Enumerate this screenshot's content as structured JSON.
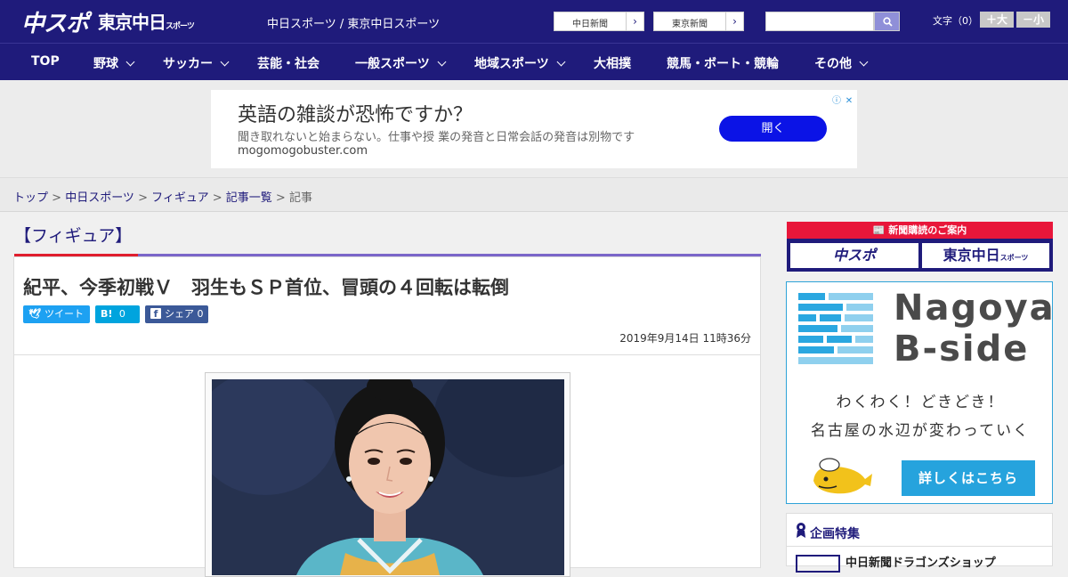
{
  "header": {
    "logo_main": "中スポ",
    "logo_tokyo": "東京中日",
    "logo_tokyo_sub": "スポーツ",
    "site_title": "中日スポーツ / 東京中日スポーツ",
    "paper_links": [
      "中日新聞",
      "東京新聞"
    ],
    "search_placeholder": "",
    "font_size_label": "文字（0）",
    "font_bigger": "＋大",
    "font_smaller": "－小"
  },
  "nav": {
    "items": [
      {
        "label": "TOP"
      },
      {
        "label": "野球"
      },
      {
        "label": "サッカー"
      },
      {
        "label": "芸能・社会"
      },
      {
        "label": "一般スポーツ"
      },
      {
        "label": "地域スポーツ"
      },
      {
        "label": "大相撲"
      },
      {
        "label": "競馬・ボート・競輪"
      },
      {
        "label": "その他"
      }
    ]
  },
  "ad": {
    "title": "英語の雑談が恐怖ですか？",
    "description": "聞き取れないと始まらない。仕事や授 業の発音と日常会話の発音は別物です",
    "url": "mogomogobuster.com",
    "button": "開く"
  },
  "breadcrumb": {
    "items": [
      "トップ",
      "中日スポーツ",
      "フィギュア",
      "記事一覧"
    ],
    "current": "記事",
    "separator": " > "
  },
  "article": {
    "category": "【フィギュア】",
    "headline": "紀平、今季初戦Ｖ　羽生もＳＰ首位、冒頭の４回転は転倒",
    "share_tweet": "ツイート",
    "share_hatena_icon": "B!",
    "share_hatena_count": "0",
    "share_fb": "シェア",
    "share_fb_count": "0",
    "date": "2019年9月14日 11時36分"
  },
  "sidebar": {
    "subscribe_head": "新聞購読のご案内",
    "subscribe_chunichi": "中スポ",
    "subscribe_tokyo": "東京中日",
    "subscribe_tokyo_sub": "スポーツ",
    "bside_name1": "Nagoya",
    "bside_name2": "B-side",
    "bside_line1": "わくわく！どきどき！",
    "bside_line2": "名古屋の水辺が変わっていく",
    "bside_button": "詳しくはこちら",
    "special_title": "企画特集",
    "special_item": "中日新聞ドラゴンズショップ"
  },
  "colors": {
    "brand_navy": "#1f1b7b",
    "accent_red": "#e01e2e",
    "accent_purple": "#7a66c9",
    "twitter": "#1da1f2",
    "hatena": "#00a4de",
    "facebook": "#3b5998",
    "ad_button": "#0b13e6",
    "bside_blue": "#26a3dd"
  }
}
